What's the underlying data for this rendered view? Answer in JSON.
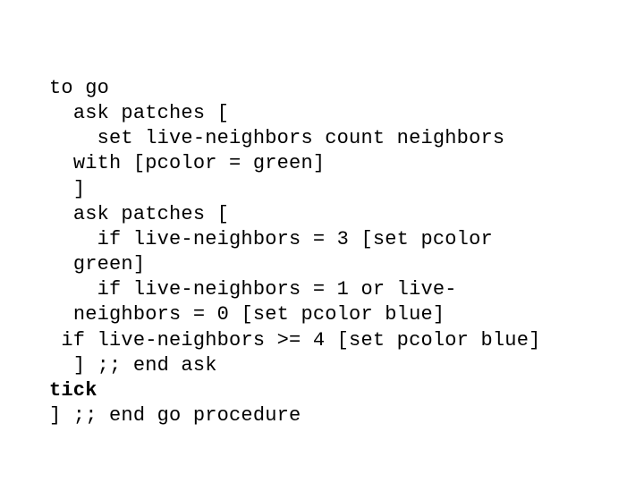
{
  "code": {
    "l01": "to go",
    "l02": "  ask patches [",
    "l03": "    set live-neighbors count neighbors",
    "l04": "  with [pcolor = green]",
    "l05": "  ]",
    "l06": "  ask patches [",
    "l07": "    if live-neighbors = 3 [set pcolor",
    "l08": "  green]",
    "l09": "    if live-neighbors = 1 or live-",
    "l10": "  neighbors = 0 [set pcolor blue]",
    "l11": " if live-neighbors >= 4 [set pcolor blue]",
    "l12": "  ] ;; end ask",
    "l13": "tick",
    "l14": "] ;; end go procedure"
  }
}
